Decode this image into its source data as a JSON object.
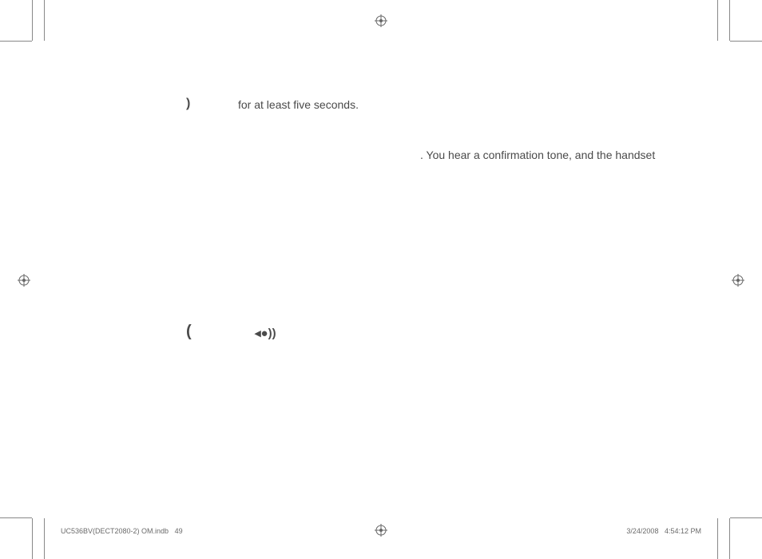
{
  "content": {
    "body_text_1": "for at least five seconds.",
    "body_text_2": ". You hear a confirmation tone, and the handset"
  },
  "icons": {
    "glyph1": ")",
    "glyph2": "(",
    "glyph3": "◂●))"
  },
  "footer": {
    "filename": "UC536BV(DECT2080-2) OM.indb",
    "page_number": "49",
    "date": "3/24/2008",
    "time": "4:54:12 PM"
  }
}
